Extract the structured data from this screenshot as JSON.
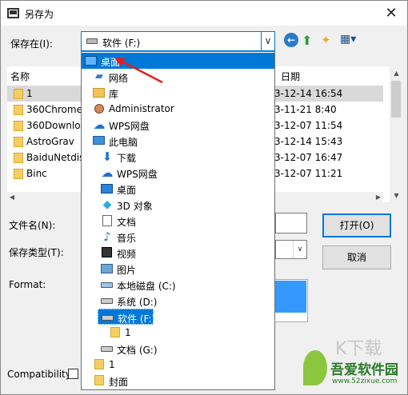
{
  "window": {
    "title": "另存为",
    "close_glyph": "✕"
  },
  "save_in": {
    "label": "保存在(I):",
    "value": "软件 (F:)",
    "arrow": "∨"
  },
  "toolbar": {
    "back_icon": "back-arrow-icon",
    "back_glyph": "←",
    "up_glyph": "⬆",
    "new_folder_glyph": "✦",
    "view_glyph": "▦▾"
  },
  "file_list": {
    "columns": {
      "name": "名称",
      "date": "日期"
    },
    "rows": [
      {
        "name": "1",
        "date": "3-12-14 16:54",
        "selected": true
      },
      {
        "name": "360Chrome",
        "date": "3-11-21 8:40"
      },
      {
        "name": "360Downlo",
        "date": "3-12-07 11:54"
      },
      {
        "name": "AstroGrav",
        "date": "3-12-14 15:43"
      },
      {
        "name": "BaiduNetdis",
        "date": "3-12-07 16:47"
      },
      {
        "name": "Binc",
        "date": "3-12-07 11:21"
      }
    ]
  },
  "filename": {
    "label": "文件名(N):",
    "value": ""
  },
  "filetype": {
    "label": "保存类型(T):"
  },
  "format": {
    "label": "Format:"
  },
  "compatibility": {
    "label": "Compatibility:"
  },
  "buttons": {
    "open": "打开(O)",
    "cancel": "取消"
  },
  "dropdown": {
    "items": [
      {
        "label": "桌面",
        "icon": "desktop-icon",
        "highlighted": true,
        "indent": 0
      },
      {
        "label": "网络",
        "icon": "network-icon",
        "indent": 1
      },
      {
        "label": "库",
        "icon": "library-icon",
        "indent": 1
      },
      {
        "label": "Administrator",
        "icon": "user-icon",
        "indent": 1
      },
      {
        "label": "WPS网盘",
        "icon": "cloud-icon",
        "indent": 1
      },
      {
        "label": "此电脑",
        "icon": "computer-icon",
        "indent": 1
      },
      {
        "label": "下载",
        "icon": "download-icon",
        "indent": 2
      },
      {
        "label": "WPS网盘",
        "icon": "cloud-icon",
        "indent": 2
      },
      {
        "label": "桌面",
        "icon": "desktop-icon",
        "indent": 2
      },
      {
        "label": "3D 对象",
        "icon": "3d-objects-icon",
        "indent": 2
      },
      {
        "label": "文档",
        "icon": "document-icon",
        "indent": 2
      },
      {
        "label": "音乐",
        "icon": "music-icon",
        "indent": 2
      },
      {
        "label": "视频",
        "icon": "video-icon",
        "indent": 2
      },
      {
        "label": "图片",
        "icon": "pictures-icon",
        "indent": 2
      },
      {
        "label": "本地磁盘 (C:)",
        "icon": "system-drive-icon",
        "indent": 2
      },
      {
        "label": "系统 (D:)",
        "icon": "drive-icon",
        "indent": 2
      },
      {
        "label": "软件 (F:)",
        "icon": "drive-icon",
        "indent": 2,
        "selected": true
      },
      {
        "label": "1",
        "icon": "folder-icon",
        "indent": 3
      },
      {
        "label": "文档 (G:)",
        "icon": "drive-icon",
        "indent": 2
      },
      {
        "label": "1",
        "icon": "folder-icon",
        "indent": 1
      },
      {
        "label": "封面",
        "icon": "folder-icon",
        "indent": 1
      }
    ]
  },
  "watermark": {
    "brand": "吾爱软件园",
    "url": "www.52zixue.com",
    "overlay": "K下载"
  },
  "colors": {
    "accent": "#0078d7",
    "annotation": "#e02020",
    "folder": "#f5cd64"
  }
}
